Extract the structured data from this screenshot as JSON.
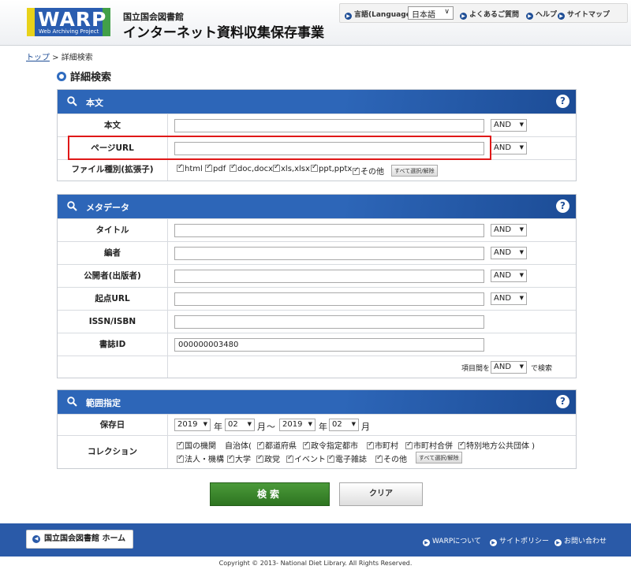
{
  "header": {
    "logo_text": "WARP",
    "logo_sub": "Web Archiving Project",
    "org_small": "国立国会図書館",
    "org_big": "インターネット資料収集保存事業",
    "language_label": "言語(Language)",
    "language_value": "日本語",
    "faq": "よくあるご質問",
    "help": "ヘルプ",
    "sitemap": "サイトマップ"
  },
  "breadcrumb": {
    "top": "トップ",
    "separator": " > ",
    "current": "詳細検索"
  },
  "page_title": "詳細検索",
  "panel_text": {
    "title": "本文",
    "rows": [
      {
        "label": "本文",
        "operator": "AND"
      },
      {
        "label": "ページURL",
        "operator": "AND"
      }
    ],
    "filetype_label": "ファイル種別(拡張子)",
    "filetypes": [
      "html",
      "pdf",
      "doc,docx",
      "xls,xlsx",
      "ppt,pptx",
      "その他"
    ],
    "select_all": "すべて選択/解除"
  },
  "panel_meta": {
    "title": "メタデータ",
    "rows": [
      {
        "label": "タイトル",
        "operator": "AND"
      },
      {
        "label": "編者",
        "operator": "AND"
      },
      {
        "label": "公開者(出版者)",
        "operator": "AND"
      },
      {
        "label": "起点URL",
        "operator": "AND"
      }
    ],
    "issn_label": "ISSN/ISBN",
    "bibid_label": "書誌ID",
    "bibid_value": "000000003480",
    "between_prefix": "項目間を",
    "between_operator": "AND",
    "between_suffix": "で検索"
  },
  "panel_range": {
    "title": "範囲指定",
    "date_label": "保存日",
    "from_year": "2019",
    "from_month": "02",
    "to_year": "2019",
    "to_month": "02",
    "year_unit": "年",
    "month_unit": "月",
    "tilde": "～",
    "collection_label": "コレクション",
    "collections_row1": [
      "国の機関",
      "都道府県",
      "政令指定都市",
      "市町村",
      "市町村合併",
      "特別地方公共団体 )"
    ],
    "jichitai_label": "自治体(",
    "collections_row2": [
      "法人・機構",
      "大学",
      "政党",
      "イベント",
      "電子雑誌",
      "その他"
    ],
    "select_all": "すべて選択/解除"
  },
  "buttons": {
    "search": "検索",
    "clear": "クリア"
  },
  "footer": {
    "home": "国立国会図書館 ホーム",
    "about": "WARPについて",
    "policy": "サイトポリシー",
    "contact": "お問い合わせ",
    "copyright": "Copyright © 2013- National Diet Library. All Rights Reserved."
  }
}
